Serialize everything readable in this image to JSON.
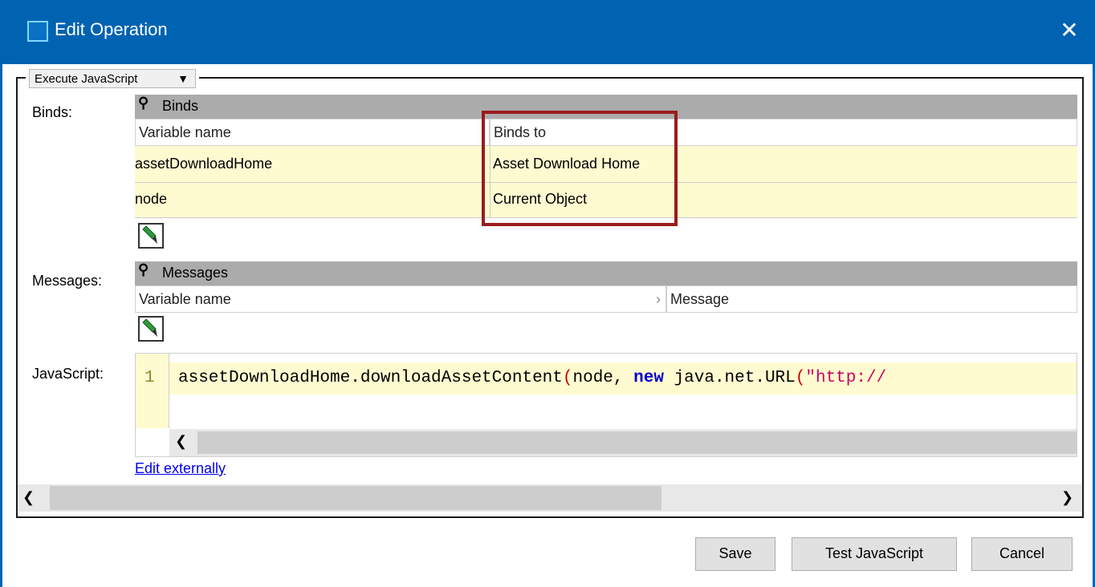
{
  "window": {
    "title": "Edit Operation",
    "close_glyph": "✕"
  },
  "operation_select": {
    "value": "Execute JavaScript"
  },
  "binds": {
    "label": "Binds:",
    "table_title": "Binds",
    "columns": [
      "Variable name",
      "Binds to"
    ],
    "rows": [
      {
        "variable": "assetDownloadHome",
        "binds_to": "Asset Download Home"
      },
      {
        "variable": "node",
        "binds_to": "Current Object"
      }
    ]
  },
  "messages": {
    "label": "Messages:",
    "table_title": "Messages",
    "columns": [
      "Variable name",
      "Message"
    ]
  },
  "javascript": {
    "label": "JavaScript:",
    "line_number": "1",
    "code": {
      "part1": "assetDownloadHome.downloadAssetContent",
      "paren": "(",
      "part2": "node, ",
      "keyword": "new",
      "part3": " java.net.URL",
      "paren2": "(",
      "string": "\"http://"
    },
    "edit_externally": "Edit externally"
  },
  "buttons": {
    "save": "Save",
    "test": "Test JavaScript",
    "cancel": "Cancel"
  },
  "colors": {
    "titlebar": "#0063b1",
    "highlight": "#9b1b1b",
    "row": "#fffbd0",
    "keyword": "#0000cc",
    "string": "#cc0066"
  }
}
